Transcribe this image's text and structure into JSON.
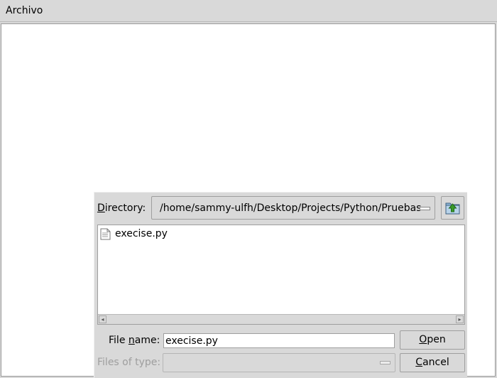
{
  "menubar": {
    "file_menu": "Archivo"
  },
  "dialog": {
    "directory_label": "Directory:",
    "directory_mnemonic": "D",
    "directory_label_rest": "irectory:",
    "directory_value": "/home/sammy-ulfh/Desktop/Projects/Python/Pruebas",
    "files": [
      {
        "name": "execise.py",
        "icon": "document-icon"
      }
    ],
    "file_name_label_pre": "File ",
    "file_name_mnemonic": "n",
    "file_name_label_post": "ame:",
    "file_name_value": "execise.py",
    "files_of_type_label": "Files of type:",
    "open_button_mnemonic": "O",
    "open_button_rest": "pen",
    "cancel_button_mnemonic": "C",
    "cancel_button_rest": "ancel"
  },
  "colors": {
    "background": "#d9d9d9",
    "canvas": "#ffffff",
    "folder_up_icon": "#3a9a2a"
  }
}
